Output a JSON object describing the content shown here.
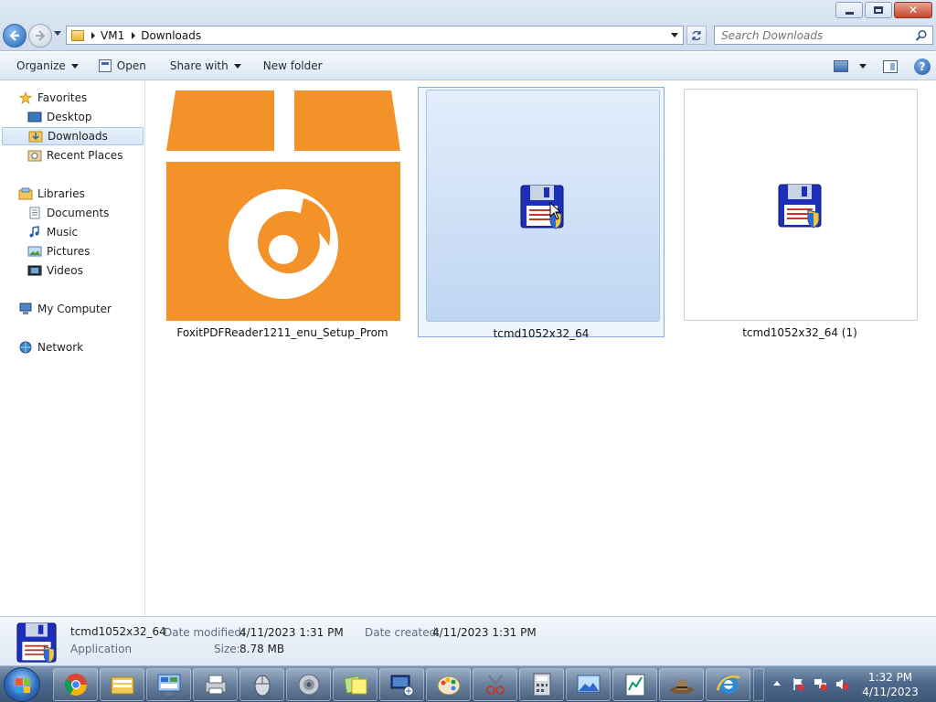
{
  "window": {
    "minimize_label": "",
    "buttons": [
      "minimize",
      "maximize",
      "close"
    ]
  },
  "address": {
    "crumbs": [
      "VM1",
      "Downloads"
    ]
  },
  "search": {
    "placeholder": "Search Downloads"
  },
  "toolbar": {
    "organize": "Organize",
    "open": "Open",
    "share_with": "Share with",
    "new_folder": "New folder"
  },
  "nav": {
    "favorites": "Favorites",
    "desktop": "Desktop",
    "downloads": "Downloads",
    "recent_places": "Recent Places",
    "libraries": "Libraries",
    "documents": "Documents",
    "music": "Music",
    "pictures": "Pictures",
    "videos": "Videos",
    "my_computer": "My Computer",
    "network": "Network",
    "selected": "Downloads"
  },
  "files": [
    {
      "name": "FoxitPDFReader1211_enu_Setup_Prom",
      "icon": "foxit-installer-icon"
    },
    {
      "name": "tcmd1052x32_64",
      "icon": "floppy-shield-icon",
      "selected": true
    },
    {
      "name": "tcmd1052x32_64 (1)",
      "icon": "floppy-shield-icon"
    }
  ],
  "details": {
    "name": "tcmd1052x32_64",
    "type": "Application",
    "date_modified_label": "Date modified:",
    "date_modified": "4/11/2023 1:31 PM",
    "date_created_label": "Date created:",
    "date_created": "4/11/2023 1:31 PM",
    "size_label": "Size:",
    "size": "8.78 MB"
  },
  "taskbar": {
    "apps": [
      "chrome-icon",
      "explorer-icon",
      "control-panel-icon",
      "printer-icon",
      "mouse-icon",
      "speaker-icon",
      "sticky-notes-icon",
      "remote-desktop-icon",
      "paint-icon",
      "snipping-tool-icon",
      "calculator-icon",
      "photo-viewer-icon",
      "notepad-chart-icon",
      "hat-icon",
      "internet-explorer-icon"
    ],
    "time": "1:32 PM",
    "date": "4/11/2023"
  },
  "colors": {
    "accent_orange": "#f39229",
    "selection_blue": "#cfe0f6",
    "taskbar": "#4e6a8d"
  }
}
